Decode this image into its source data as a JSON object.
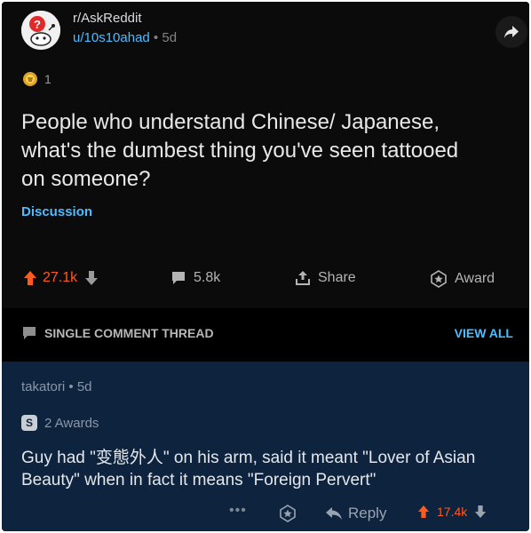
{
  "post": {
    "subreddit": "r/AskReddit",
    "username": "u/10s10ahad",
    "separator": "•",
    "age": "5d",
    "award_count": "1",
    "title": "People who understand Chinese/ Japanese, what's the dumbest thing you've seen tattooed on someone?",
    "flair": "Discussion",
    "upvotes": "27.1k",
    "comments": "5.8k",
    "share_label": "Share",
    "award_label": "Award"
  },
  "thread": {
    "label": "SINGLE COMMENT THREAD",
    "view_all": "VIEW ALL"
  },
  "comment": {
    "author": "takatori",
    "separator": "•",
    "age": "5d",
    "awards": "2 Awards",
    "award_badge": "S",
    "body": "Guy had \"变態外人\" on his arm, said it meant \"Lover of Asian Beauty\" when in fact it means \"Foreign Pervert\"",
    "more": "•••",
    "reply_label": "Reply",
    "votes": "17.4k"
  },
  "colors": {
    "accent_blue": "#4fbcff",
    "upvote_orange": "#ff5a1f",
    "comment_bg": "#0e233d",
    "post_bg": "#0b0b0b"
  }
}
